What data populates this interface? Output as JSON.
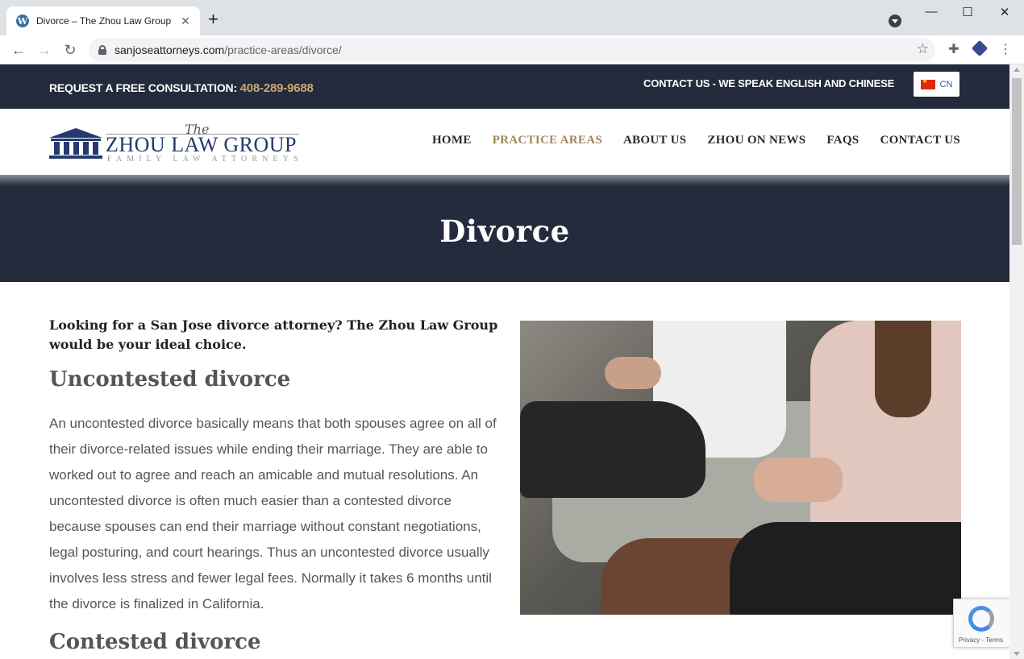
{
  "browser": {
    "tab_title": "Divorce – The Zhou Law Group",
    "tab_favicon_letter": "W",
    "close_glyph": "✕",
    "new_tab_glyph": "+",
    "url_host": "sanjoseattorneys.com",
    "url_path": "/practice-areas/divorce/",
    "back_glyph": "←",
    "forward_glyph": "→",
    "reload_glyph": "↻",
    "star_glyph": "☆",
    "puzzle_glyph": "✚",
    "menu_glyph": "⋮",
    "minimize_glyph": "—",
    "maximize_glyph": "☐",
    "window_close_glyph": "✕"
  },
  "topbar": {
    "consult_label": "REQUEST A FREE CONSULTATION:",
    "phone": "408-289-9688",
    "contact_text": "CONTACT US - WE SPEAK ENGLISH AND CHINESE",
    "lang_label": "CN"
  },
  "logo": {
    "the": "The",
    "name": "ZHOU LAW GROUP",
    "tagline": "FAMILY LAW ATTORNEYS"
  },
  "nav": {
    "items": [
      {
        "label": "HOME"
      },
      {
        "label": "PRACTICE AREAS"
      },
      {
        "label": "ABOUT US"
      },
      {
        "label": "ZHOU ON NEWS"
      },
      {
        "label": "FAQS"
      },
      {
        "label": "CONTACT US"
      }
    ],
    "active_color": "#a3865a"
  },
  "hero": {
    "title": "Divorce"
  },
  "content": {
    "lead": "Looking for a San Jose divorce attorney? The Zhou Law Group would be your ideal choice.",
    "heading_uncontested": "Uncontested divorce",
    "paragraph": "An uncontested divorce basically means that both spouses agree on all of their divorce-related issues while ending their marriage.  They are able to worked out to agree and reach an amicable and mutual resolutions.  An uncontested divorce is often much easier than a contested divorce because spouses can end their marriage without constant negotiations, legal posturing, and court hearings. Thus an uncontested divorce usually involves less stress and fewer legal fees. Normally it takes 6 months until the divorce is finalized in California.",
    "heading_contested": "Contested divorce"
  },
  "recaptcha": {
    "text": "Privacy - Terms"
  },
  "colors": {
    "navy": "#232b3d",
    "gold": "#c8a872",
    "logo_blue": "#24396e"
  }
}
